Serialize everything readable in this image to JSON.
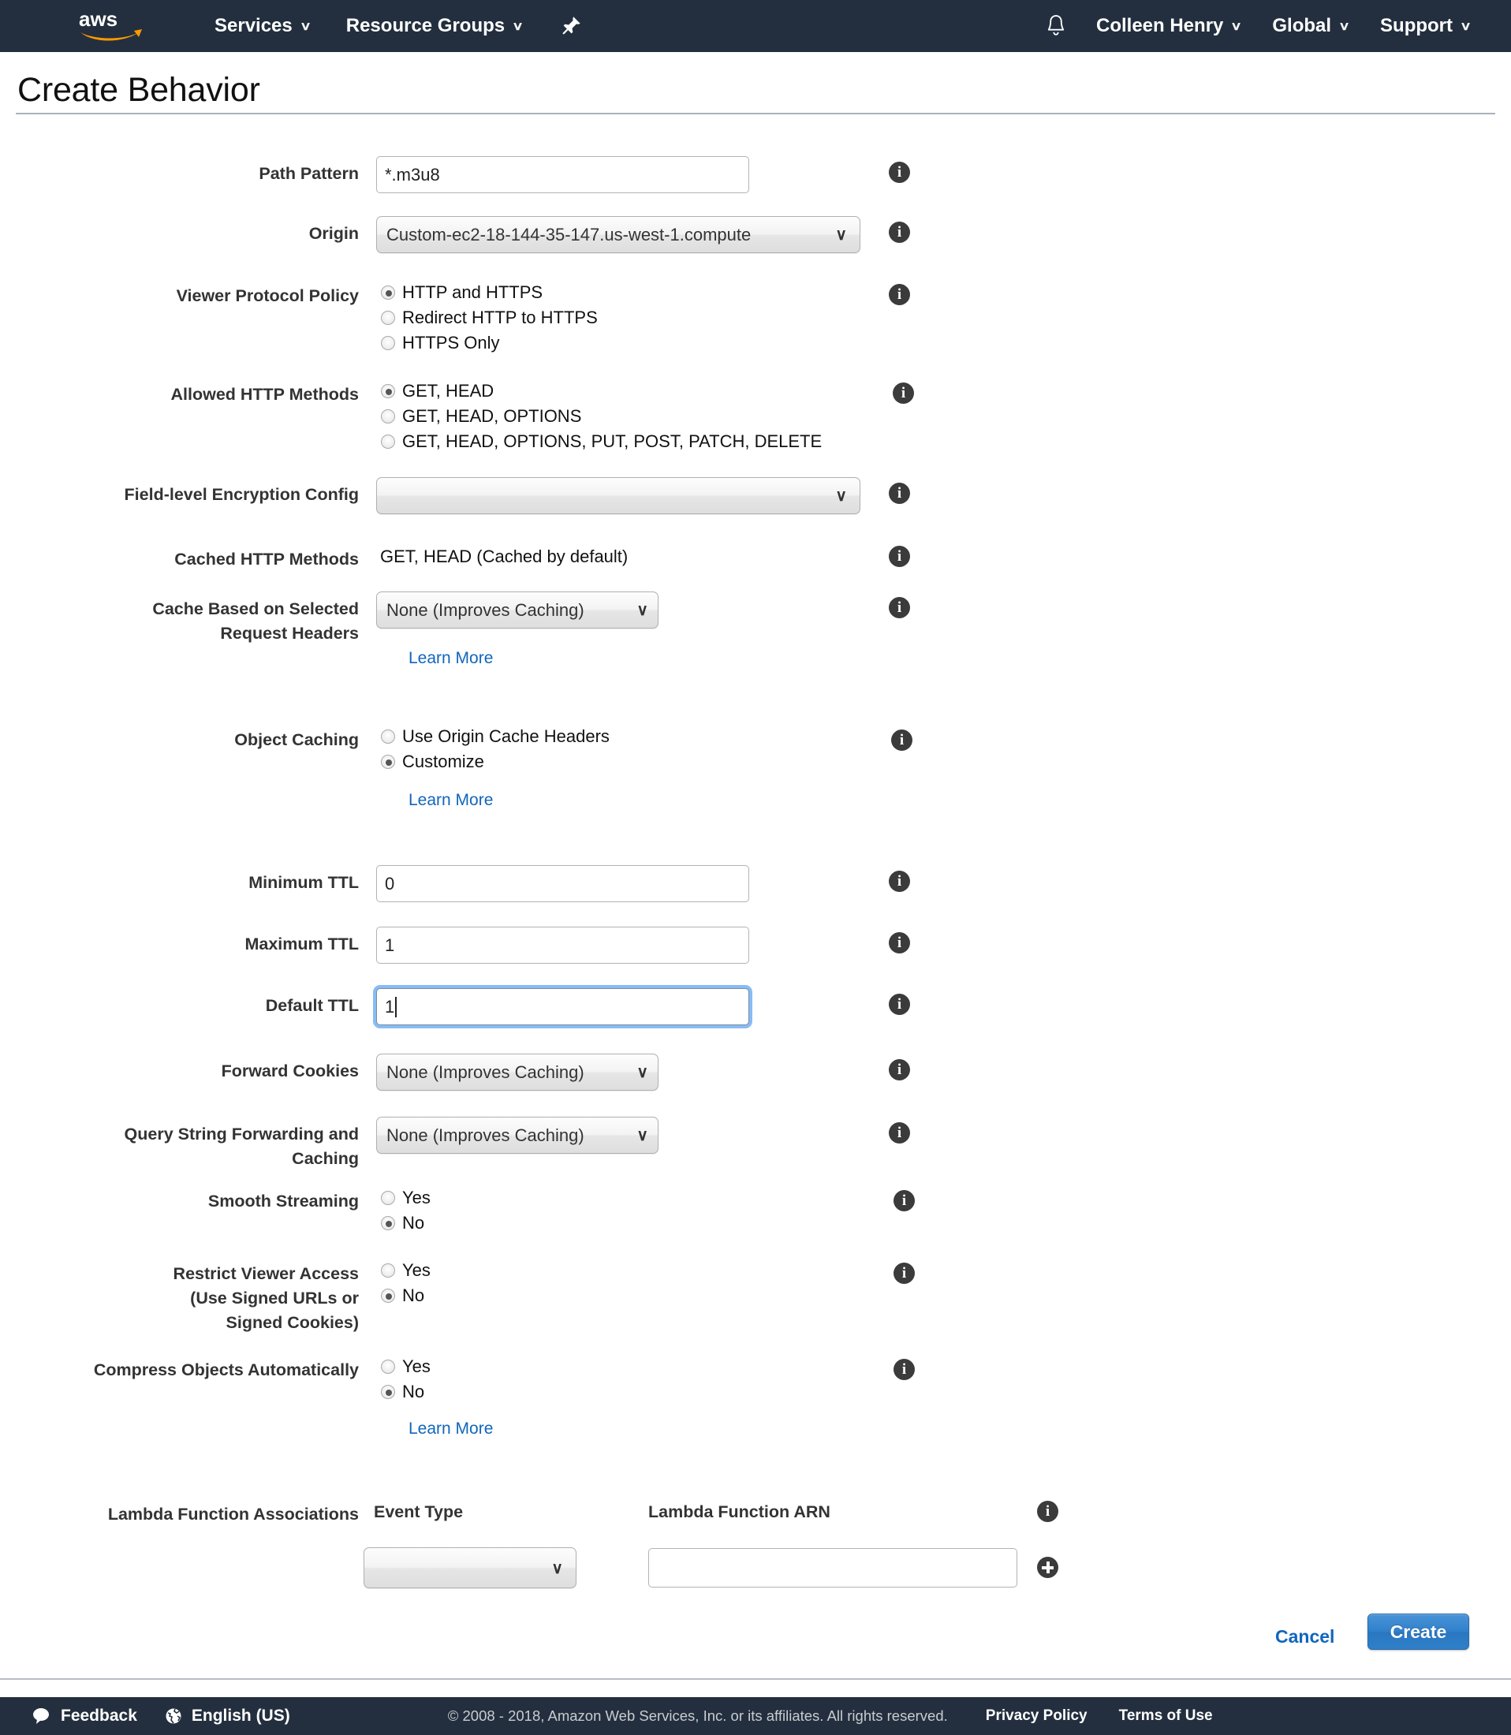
{
  "topnav": {
    "logo_alt": "aws",
    "left_items": [
      {
        "label": "Services",
        "caret": "∨"
      },
      {
        "label": "Resource Groups",
        "caret": "∨"
      }
    ],
    "pin_icon": "pushpin-icon",
    "bell_icon": "notifications-bell-icon",
    "right_items": [
      {
        "label": "Colleen Henry",
        "caret": "∨"
      },
      {
        "label": "Global",
        "caret": "∨"
      },
      {
        "label": "Support",
        "caret": "∨"
      }
    ]
  },
  "page": {
    "title": "Create Behavior"
  },
  "form": {
    "path_pattern": {
      "label": "Path Pattern",
      "value": "*.m3u8"
    },
    "origin": {
      "label": "Origin",
      "value": "Custom-ec2-18-144-35-147.us-west-1.compute",
      "caret": "∨"
    },
    "viewer_protocol_policy": {
      "label": "Viewer Protocol Policy",
      "options": [
        {
          "label": "HTTP and HTTPS",
          "selected": true
        },
        {
          "label": "Redirect HTTP to HTTPS",
          "selected": false
        },
        {
          "label": "HTTPS Only",
          "selected": false
        }
      ]
    },
    "allowed_http_methods": {
      "label": "Allowed HTTP Methods",
      "options": [
        {
          "label": "GET, HEAD",
          "selected": true
        },
        {
          "label": "GET, HEAD, OPTIONS",
          "selected": false
        },
        {
          "label": "GET, HEAD, OPTIONS, PUT, POST, PATCH, DELETE",
          "selected": false
        }
      ]
    },
    "field_level_encryption": {
      "label": "Field-level Encryption Config",
      "value": "",
      "caret": "∨"
    },
    "cached_http_methods": {
      "label": "Cached HTTP Methods",
      "value": "GET, HEAD (Cached by default)"
    },
    "cache_based_on_headers": {
      "label_line1": "Cache Based on Selected",
      "label_line2": "Request Headers",
      "value": "None (Improves Caching)",
      "caret": "∨",
      "learn_more": "Learn More"
    },
    "object_caching": {
      "label": "Object Caching",
      "options": [
        {
          "label": "Use Origin Cache Headers",
          "selected": false
        },
        {
          "label": "Customize",
          "selected": true
        }
      ],
      "learn_more": "Learn More"
    },
    "minimum_ttl": {
      "label": "Minimum TTL",
      "value": "0"
    },
    "maximum_ttl": {
      "label": "Maximum TTL",
      "value": "1"
    },
    "default_ttl": {
      "label": "Default TTL",
      "value": "1",
      "focused": true
    },
    "forward_cookies": {
      "label": "Forward Cookies",
      "value": "None (Improves Caching)",
      "caret": "∨"
    },
    "query_string_forwarding": {
      "label_line1": "Query String Forwarding and",
      "label_line2": "Caching",
      "value": "None (Improves Caching)",
      "caret": "∨"
    },
    "smooth_streaming": {
      "label": "Smooth Streaming",
      "options": [
        {
          "label": "Yes",
          "selected": false
        },
        {
          "label": "No",
          "selected": true
        }
      ]
    },
    "restrict_viewer_access": {
      "label_line1": "Restrict Viewer Access",
      "label_line2": "(Use Signed URLs or",
      "label_line3": "Signed Cookies)",
      "options": [
        {
          "label": "Yes",
          "selected": false
        },
        {
          "label": "No",
          "selected": true
        }
      ]
    },
    "compress_objects": {
      "label": "Compress Objects Automatically",
      "options": [
        {
          "label": "Yes",
          "selected": false
        },
        {
          "label": "No",
          "selected": true
        }
      ],
      "learn_more": "Learn More"
    },
    "lambda": {
      "label": "Lambda Function Associations",
      "event_type_header": "Event Type",
      "arn_header": "Lambda Function ARN",
      "event_type_value": "",
      "event_type_caret": "∨",
      "arn_value": "",
      "add_icon": "plus-circle-icon"
    }
  },
  "actions": {
    "cancel": "Cancel",
    "create": "Create"
  },
  "footer": {
    "feedback": "Feedback",
    "language": "English (US)",
    "copyright": "© 2008 - 2018, Amazon Web Services, Inc. or its affiliates. All rights reserved.",
    "privacy_policy": "Privacy Policy",
    "terms_of_use": "Terms of Use"
  }
}
